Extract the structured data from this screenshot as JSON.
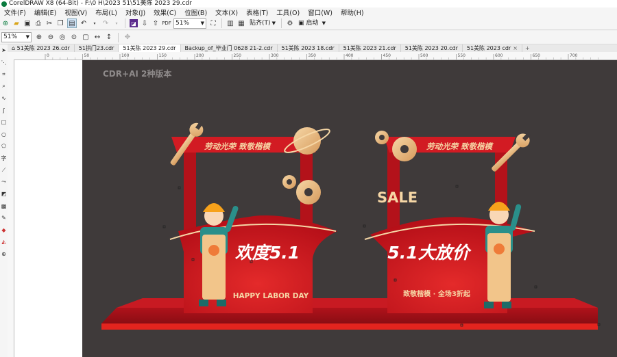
{
  "app": {
    "title": "CorelDRAW X8 (64-Bit) - F:\\0 H\\2023 51\\51美陈 2023 29.cdr"
  },
  "menu": [
    "文件(F)",
    "编辑(E)",
    "视图(V)",
    "布局(L)",
    "对象(J)",
    "效果(C)",
    "位图(B)",
    "文本(X)",
    "表格(T)",
    "工具(O)",
    "窗口(W)",
    "帮助(H)"
  ],
  "toolbar": {
    "zoom_value": "51%",
    "snap_label": "贴齐(T)",
    "launch_label": "启动"
  },
  "toolbar2": {
    "zoom_value": "51%"
  },
  "tabs": [
    {
      "label": "51美陈 2023 26.cdr",
      "active": false
    },
    {
      "label": "51拱门23.cdr",
      "active": false
    },
    {
      "label": "51美陈 2023 29.cdr",
      "active": true
    },
    {
      "label": "Backup_of_毕业门 0628 21-2.cdr",
      "active": false
    },
    {
      "label": "51美陈 2023 18.cdr",
      "active": false
    },
    {
      "label": "51美陈 2023 21.cdr",
      "active": false
    },
    {
      "label": "51美陈 2023 20.cdr",
      "active": false
    },
    {
      "label": "51美陈 2023 cdr",
      "active": false
    }
  ],
  "ruler": {
    "labels": [
      "0",
      "50",
      "100",
      "150",
      "200",
      "250",
      "300",
      "350",
      "400",
      "450",
      "500",
      "550",
      "600",
      "650",
      "700"
    ]
  },
  "canvas": {
    "watermark": "CDR+AI 2种版本",
    "left_board": {
      "banner": "劳动光荣 致敬楷模",
      "headline": "欢度5.1",
      "subline": "HAPPY LABOR DAY"
    },
    "right_board": {
      "banner": "劳动光荣 致敬楷模",
      "sale": "SALE",
      "headline": "5.1大放价",
      "subline": "致敬楷模 · 全场3折起"
    }
  },
  "colors": {
    "canvas_bg": "#3f3a3a",
    "board_red": "#c8141e",
    "dark_red": "#a10d15",
    "gold": "#e8b87a",
    "worker_teal": "#2a8f8a",
    "helmet": "#f7a21b"
  }
}
